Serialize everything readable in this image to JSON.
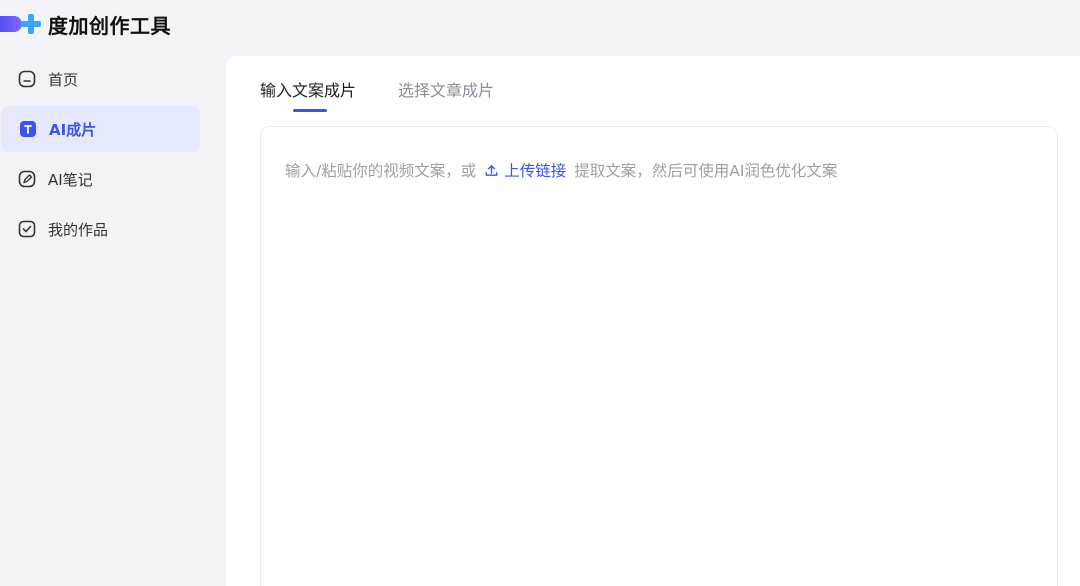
{
  "app": {
    "title": "度加创作工具",
    "colors": {
      "accent": "#3b54ea",
      "logo_purple": "#5a4ff5",
      "logo_blue": "#3aa7ff"
    }
  },
  "sidebar": {
    "items": [
      {
        "label": "首页",
        "icon": "home-icon",
        "active": false
      },
      {
        "label": "AI成片",
        "icon": "text-badge-icon",
        "active": true
      },
      {
        "label": "AI笔记",
        "icon": "pen-icon",
        "active": false
      },
      {
        "label": "我的作品",
        "icon": "check-box-icon",
        "active": false
      }
    ]
  },
  "main": {
    "tabs": [
      {
        "label": "输入文案成片",
        "active": true
      },
      {
        "label": "选择文章成片",
        "active": false
      }
    ],
    "editor": {
      "placeholder_before": "输入/粘贴你的视频文案，或",
      "upload_link": "上传链接",
      "placeholder_after": "提取文案，然后可使用AI润色优化文案"
    }
  }
}
